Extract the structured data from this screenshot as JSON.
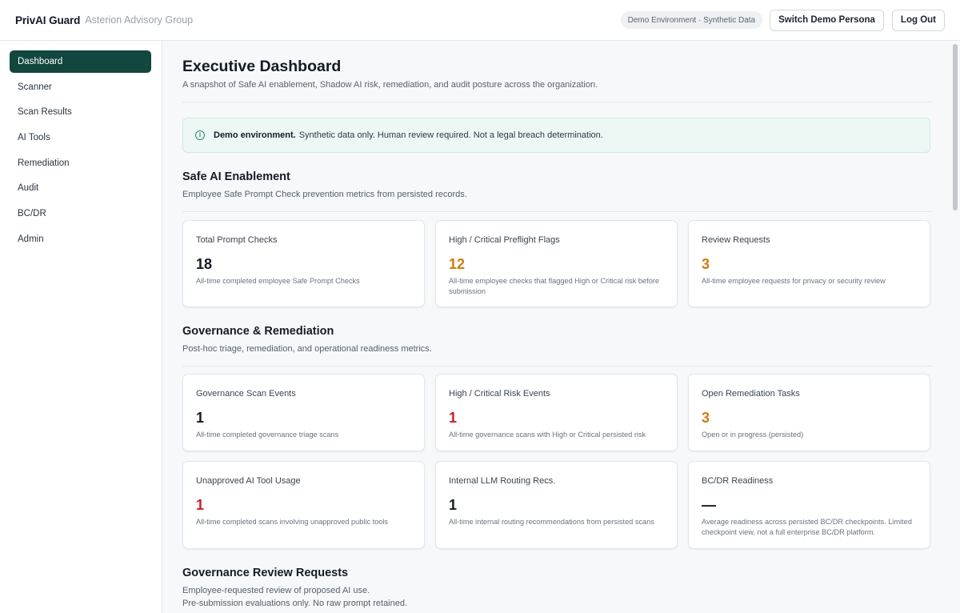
{
  "header": {
    "brand": "PrivAI Guard",
    "org": "Asterion Advisory Group",
    "env_badge": "Demo Environment · Synthetic Data",
    "switch_persona_label": "Switch Demo Persona",
    "logout_label": "Log Out"
  },
  "sidebar": {
    "items": [
      {
        "label": "Dashboard",
        "active": true
      },
      {
        "label": "Scanner"
      },
      {
        "label": "Scan Results"
      },
      {
        "label": "AI Tools"
      },
      {
        "label": "Remediation"
      },
      {
        "label": "Audit"
      },
      {
        "label": "BC/DR"
      },
      {
        "label": "Admin"
      }
    ]
  },
  "page": {
    "title": "Executive Dashboard",
    "subtitle": "A snapshot of Safe AI enablement, Shadow AI risk, remediation, and audit posture across the organization."
  },
  "notice": {
    "icon": "info-icon",
    "bold": "Demo environment.",
    "text": "Synthetic data only. Human review required. Not a legal breach determination."
  },
  "sections": {
    "enablement": {
      "title": "Safe AI Enablement",
      "subtitle": "Employee Safe Prompt Check prevention metrics from persisted records.",
      "cards": [
        {
          "label": "Total Prompt Checks",
          "value": "18",
          "desc": "All-time completed employee Safe Prompt Checks"
        },
        {
          "label": "High / Critical Preflight Flags",
          "value": "12",
          "desc": "All-time employee checks that flagged High or Critical risk before submission"
        },
        {
          "label": "Review Requests",
          "value": "3",
          "desc": "All-time employee requests for privacy or security review"
        }
      ]
    },
    "governance": {
      "title": "Governance & Remediation",
      "subtitle": "Post-hoc triage, remediation, and operational readiness metrics.",
      "cards": [
        {
          "label": "Governance Scan Events",
          "value": "1",
          "desc": "All-time completed governance triage scans"
        },
        {
          "label": "High / Critical Risk Events",
          "value": "1",
          "desc": "All-time governance scans with High or Critical persisted risk"
        },
        {
          "label": "Open Remediation Tasks",
          "value": "3",
          "desc": "Open or in progress (persisted)"
        },
        {
          "label": "Unapproved AI Tool Usage",
          "value": "1",
          "desc": "All-time completed scans involving unapproved public tools"
        },
        {
          "label": "Internal LLM Routing Recs.",
          "value": "1",
          "desc": "All-time internal routing recommendations from persisted scans"
        },
        {
          "label": "BC/DR Readiness",
          "value": "—",
          "desc": "Average readiness across persisted BC/DR checkpoints. Limited checkpoint view, not a full enterprise BC/DR platform."
        }
      ]
    },
    "review": {
      "title": "Governance Review Requests",
      "subtitle_line1": "Employee-requested review of proposed AI use.",
      "subtitle_line2": "Pre-submission evaluations only. No raw prompt retained."
    }
  },
  "colors": {
    "accent": "#11473e",
    "warning": "#d27a10",
    "danger": "#c8202b",
    "notice_bg": "#edf8f5"
  }
}
